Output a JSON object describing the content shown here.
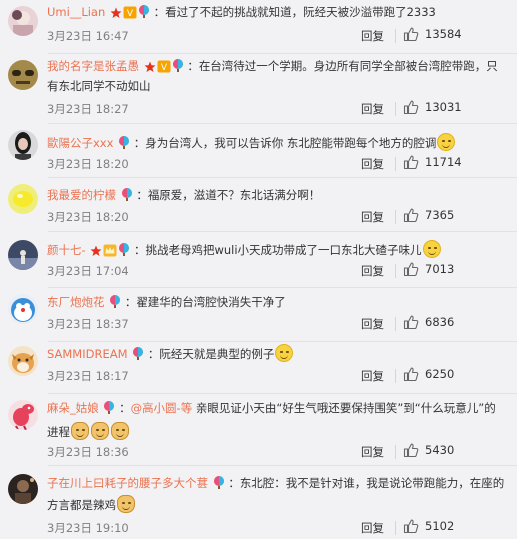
{
  "comments": [
    {
      "name": "Umi__Lian",
      "badges": [
        "star",
        "v",
        "balloon"
      ],
      "text": "看过了不起的挑战就知道，阮经天被沙溢带跑了2333",
      "emoji": [],
      "time": "3月23日 16:47",
      "reply": "回复",
      "likes": "13584",
      "avatar": "photo-pink"
    },
    {
      "name": "我的名字是张孟愚",
      "badges": [
        "star",
        "v",
        "balloon"
      ],
      "text": "在台湾待过一个学期。身边所有同学全部被台湾腔带跑，只有东北同学不动如山",
      "emoji": [],
      "time": "3月23日 18:27",
      "reply": "回复",
      "likes": "13031",
      "avatar": "photo-olive"
    },
    {
      "name": "歐陽公子xxx",
      "badges": [
        "balloon"
      ],
      "text": "身为台湾人，我可以告诉你 东北腔能带跑每个地方的腔调",
      "emoji": [
        "smile"
      ],
      "time": "3月23日 18:20",
      "reply": "回复",
      "likes": "11714",
      "avatar": "photo-dark"
    },
    {
      "name": "我最爱的柠檬",
      "badges": [
        "balloon"
      ],
      "text": "福原爱，滋道不？东北话满分啊！",
      "emoji": [],
      "time": "3月23日 18:20",
      "reply": "回复",
      "likes": "7365",
      "avatar": "yellow"
    },
    {
      "name": "颜十七-",
      "badges": [
        "star",
        "crown",
        "balloon"
      ],
      "text": "挑战老母鸡把wuli小天成功带成了一口东北大碴子味儿",
      "emoji": [
        "smile"
      ],
      "time": "3月23日 17:04",
      "reply": "回复",
      "likes": "7013",
      "avatar": "photo-stage"
    },
    {
      "name": "东厂炮炮花",
      "badges": [
        "balloon"
      ],
      "text": "翟建华的台湾腔快消失干净了",
      "emoji": [],
      "time": "3月23日 18:37",
      "reply": "回复",
      "likes": "6836",
      "avatar": "cartoon-blue"
    },
    {
      "name": "SAMMIDREAM",
      "badges": [
        "balloon"
      ],
      "text": "阮经天就是典型的例子",
      "emoji": [
        "smile"
      ],
      "time": "3月23日 18:17",
      "reply": "回复",
      "likes": "6250",
      "avatar": "dog"
    },
    {
      "name": "麻朵_姑娘",
      "badges": [
        "balloon"
      ],
      "mention": "@高小圆-等",
      "text": "亲眼见证小天由“好生气哦还要保持围笑”到“什么玩意儿”的进程",
      "emoji": [
        "doge",
        "doge",
        "doge"
      ],
      "time": "3月23日 18:36",
      "reply": "回复",
      "likes": "5430",
      "avatar": "dino"
    },
    {
      "name": "子在川上曰耗子的腰子多大个葚",
      "badges": [
        "balloon"
      ],
      "text": "东北腔：我不是针对谁，我是说论带跑能力，在座的方言都是辣鸡",
      "emoji": [
        "doge"
      ],
      "time": "3月23日 19:10",
      "reply": "回复",
      "likes": "5102",
      "avatar": "photo-night"
    }
  ]
}
